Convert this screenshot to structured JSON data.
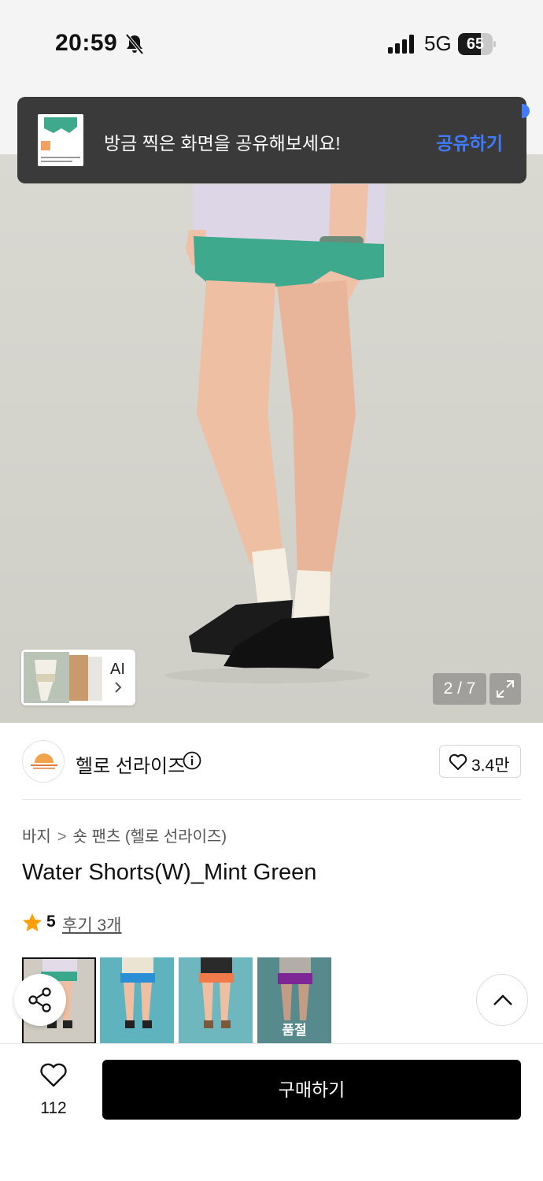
{
  "status_bar": {
    "time": "20:59",
    "network": "5G",
    "battery": "65",
    "battery_level": 0.65
  },
  "toast": {
    "message": "방금 찍은 화면을 공유해보세요!",
    "action": "공유하기"
  },
  "gallery": {
    "ai_label": "AI",
    "counter": "2 / 7"
  },
  "brand": {
    "name": "헬로 선라이즈",
    "likes": "3.4만"
  },
  "breadcrumb": {
    "category": "바지",
    "subcategory": "숏 팬츠 (헬로 선라이즈)"
  },
  "product": {
    "title": "Water Shorts(W)_Mint Green",
    "rating": "5",
    "reviews": "후기 3개"
  },
  "swatches": [
    {
      "color": "#3aa88a",
      "bg": "#cfcbc2",
      "selected": true
    },
    {
      "color": "#2b8fd8",
      "bg": "#5fb3bf",
      "selected": false
    },
    {
      "color": "#f07a4a",
      "bg": "#6fb7bf",
      "selected": false
    },
    {
      "color": "#9b2fb8",
      "bg": "#6aa9ad",
      "selected": false,
      "label": "품절"
    }
  ],
  "bottom_bar": {
    "wish_count": "112",
    "buy_label": "구매하기"
  },
  "colors": {
    "accent_blue": "#3f7bff",
    "star": "#ff9f0a"
  }
}
